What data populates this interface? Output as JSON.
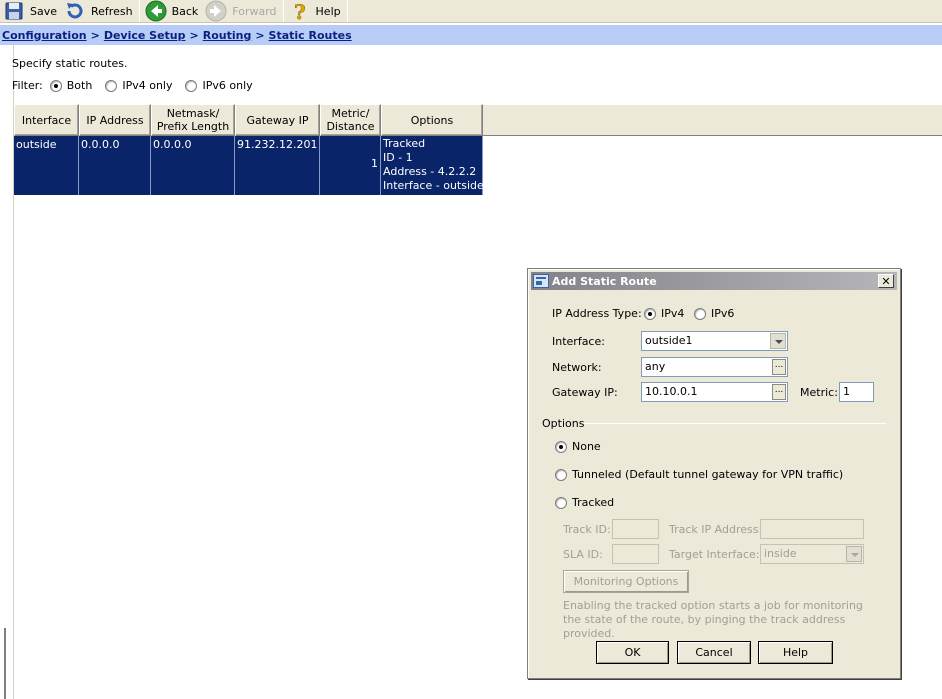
{
  "toolbar": {
    "save_label": "Save",
    "refresh_label": "Refresh",
    "back_label": "Back",
    "forward_label": "Forward",
    "help_label": "Help"
  },
  "breadcrumb": {
    "items": [
      "Configuration",
      "Device Setup",
      "Routing",
      "Static Routes"
    ],
    "separator": ">"
  },
  "page": {
    "description": "Specify static routes.",
    "filter_label": "Filter:",
    "filter_options": [
      "Both",
      "IPv4 only",
      "IPv6 only"
    ],
    "filter_selected": "Both"
  },
  "table": {
    "columns": [
      "Interface",
      "IP Address",
      "Netmask/\nPrefix Length",
      "Gateway IP",
      "Metric/\nDistance",
      "Options"
    ],
    "rows": [
      {
        "interface": "outside",
        "ip_address": "0.0.0.0",
        "netmask": "0.0.0.0",
        "gateway_ip": "91.232.12.201",
        "metric": "1",
        "options": [
          "Tracked",
          "ID - 1",
          "Address - 4.2.2.2",
          "Interface - outside"
        ]
      }
    ]
  },
  "dialog": {
    "title": "Add Static Route",
    "close_label": "✕",
    "ip_type_label": "IP Address Type:",
    "ip_type_options": [
      "IPv4",
      "IPv6"
    ],
    "ip_type_selected": "IPv4",
    "interface_label": "Interface:",
    "interface_value": "outside1",
    "network_label": "Network:",
    "network_value": "any",
    "gateway_label": "Gateway IP:",
    "gateway_value": "10.10.0.1",
    "metric_label": "Metric:",
    "metric_value": "1",
    "ellipsis": "...",
    "options_group_label": "Options",
    "option_none": "None",
    "option_tunneled": "Tunneled (Default tunnel gateway for VPN traffic)",
    "option_tracked": "Tracked",
    "option_selected": "None",
    "track_id_label": "Track ID:",
    "track_ip_label": "Track IP Address:",
    "sla_id_label": "SLA ID:",
    "target_interface_label": "Target Interface:",
    "target_interface_value": "inside",
    "monitoring_options_label": "Monitoring Options",
    "note": "Enabling the tracked option starts a job for monitoring the state of the route, by pinging the track address provided.",
    "ok_label": "OK",
    "cancel_label": "Cancel",
    "help_label": "Help"
  }
}
